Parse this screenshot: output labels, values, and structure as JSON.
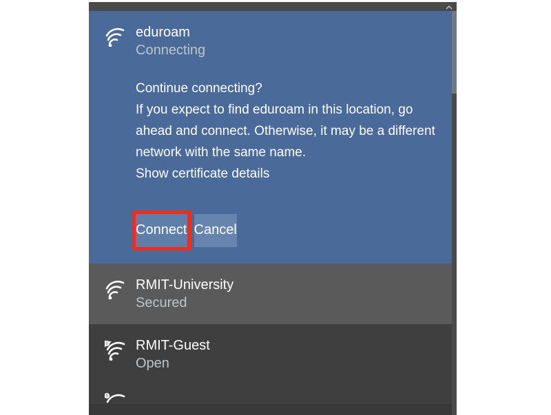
{
  "active_network": {
    "name": "eduroam",
    "status": "Connecting",
    "prompt_title": "Continue connecting?",
    "prompt_body": "If you expect to find eduroam in this location, go ahead and connect. Otherwise, it may be a different network with the same name.",
    "cert_link": "Show certificate details",
    "connect_label": "Connect",
    "cancel_label": "Cancel"
  },
  "networks": [
    {
      "name": "RMIT-University",
      "status": "Secured",
      "icon": "wifi"
    },
    {
      "name": "RMIT-Guest",
      "status": "Open",
      "icon": "wifi-open"
    }
  ]
}
